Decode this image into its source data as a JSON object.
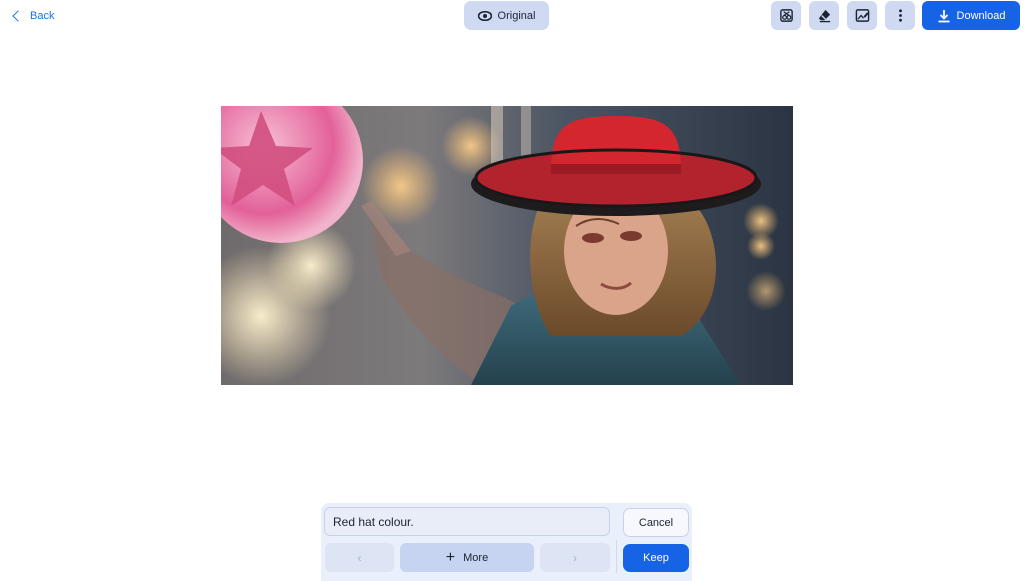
{
  "topbar": {
    "back_label": "Back",
    "original_label": "Original",
    "download_label": "Download",
    "tools": [
      "remove-object-icon",
      "eraser-icon",
      "edit-image-icon",
      "more-vertical-icon"
    ]
  },
  "canvas": {
    "image": "woman-red-hat-pointing-icon"
  },
  "prompt": {
    "value": "Red hat colour.",
    "cancel_label": "Cancel",
    "prev_glyph": "‹",
    "next_glyph": "›",
    "more_label": "More",
    "keep_label": "Keep"
  },
  "colors": {
    "accent": "#1763e5",
    "tool_bg": "#cfdaf2",
    "panel_bg": "#eaf0fb"
  }
}
